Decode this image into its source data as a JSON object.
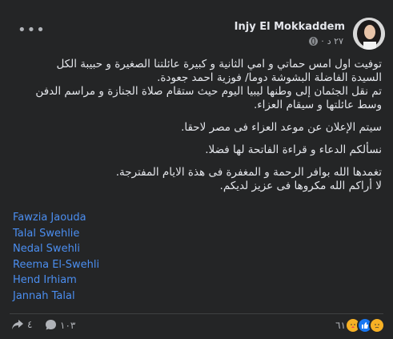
{
  "post": {
    "author": "Injy El Mokkaddem",
    "time": "٢٧ د",
    "paragraphs": [
      [
        "توفيت اول امس حماتي و امي الثانية و كبيرة عائلتنا الصغيرة و حبيبة الكل",
        "السيدة الفاضلة البشوشة دوما/ فوزية احمد جعودة.",
        "تم نقل الجثمان إلى وطنها ليبيا اليوم حيث ستقام صلاة الجنازة و مراسم الدفن",
        "وسط عائلتها و سيقام العزاء."
      ],
      [
        "سيتم الإعلان عن موعد العزاء فى مصر لاحقا."
      ],
      [
        "نسألكم الدعاء و قراءة الفاتحة لها فضلا."
      ],
      [
        "تغمدها الله بوافر الرحمة و المغفرة فى هذة الايام المفترجة.",
        "لا أراكم الله مكروها فى عزيز لديكم."
      ]
    ],
    "tags": [
      "Fawzia Jaouda",
      "Talal Swehlie",
      "Nedal Swehli",
      "Reema El-Swehli",
      "Hend Irhiam",
      "Jannah Talal"
    ]
  },
  "footer": {
    "shares_count": "٤",
    "comments_count": "١٠٣",
    "reactions_count": "٦١"
  },
  "icons": {
    "more": "more-dots-icon",
    "audience": "globe-icon",
    "share": "share-icon",
    "comment": "comment-icon",
    "reactions": [
      "care-icon",
      "like-icon",
      "sad-icon"
    ]
  },
  "colors": {
    "background": "#242526",
    "text": "#e4e6eb",
    "secondary": "#b0b3b8",
    "link": "#4b8ef0",
    "like": "#1877f2",
    "sad": "#f7b125"
  }
}
